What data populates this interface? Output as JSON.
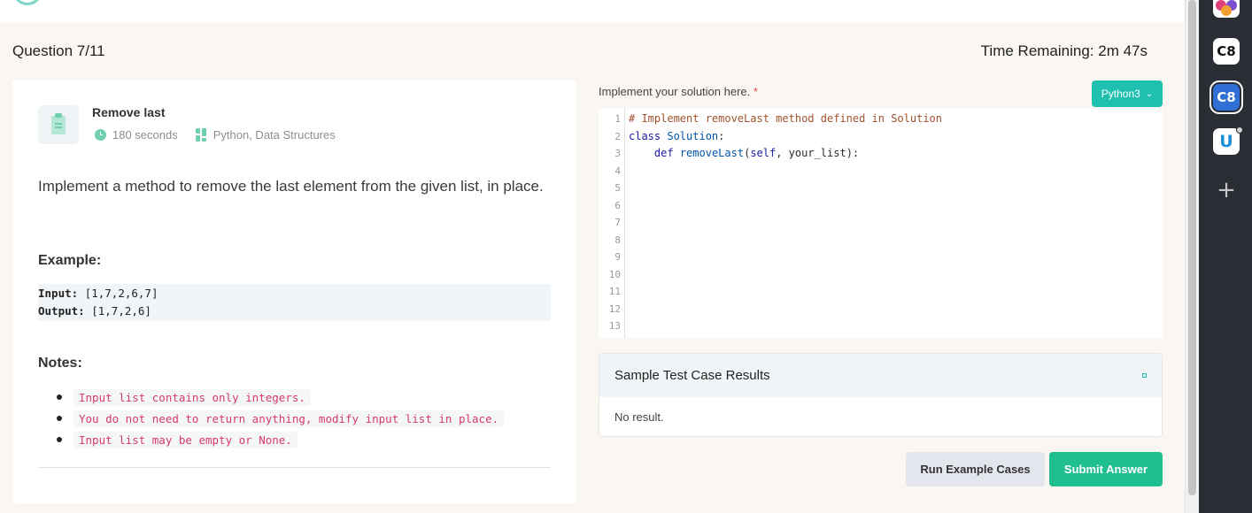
{
  "header": {
    "question_counter": "Question 7/11",
    "time_remaining": "Time Remaining: 2m 47s"
  },
  "question": {
    "title": "Remove last",
    "duration": "180 seconds",
    "tags": "Python, Data Structures",
    "description": "Implement a method to remove the last element from the given list, in place.",
    "example_heading": "Example:",
    "example": {
      "input_label": "Input:",
      "input_value": "[1,7,2,6,7]",
      "output_label": "Output:",
      "output_value": "[1,7,2,6]"
    },
    "notes_heading": "Notes:",
    "notes": [
      "Input list contains only integers.",
      "You do not need to return anything, modify input list in place.",
      "Input list may be empty or None."
    ]
  },
  "editor": {
    "label": "Implement your solution here.",
    "required_mark": "*",
    "language": "Python3",
    "line_numbers": [
      "1",
      "2",
      "3",
      "4",
      "5",
      "6",
      "7",
      "8",
      "9",
      "10",
      "11",
      "12",
      "13"
    ],
    "code": {
      "line1": "# Implement removeLast method defined in Solution",
      "line2_kw": "class",
      "line2_name": "Solution",
      "line2_colon": ":",
      "line3_indent": "    ",
      "line3_kw": "def",
      "line3_fn": "removeLast",
      "line3_open": "(",
      "line3_self": "self",
      "line3_rest": ", your_list):"
    }
  },
  "results": {
    "title": "Sample Test Case Results",
    "body": "No result."
  },
  "actions": {
    "run_label": "Run Example Cases",
    "submit_label": "Submit Answer"
  },
  "extensions": {
    "c8_label": "C8",
    "c8_active_label": "C8",
    "u_label": "U",
    "add_label": "+"
  },
  "colors": {
    "accent_teal": "#20c0b0",
    "submit_green": "#1fbf8f",
    "note_pink": "#d63a6f"
  }
}
